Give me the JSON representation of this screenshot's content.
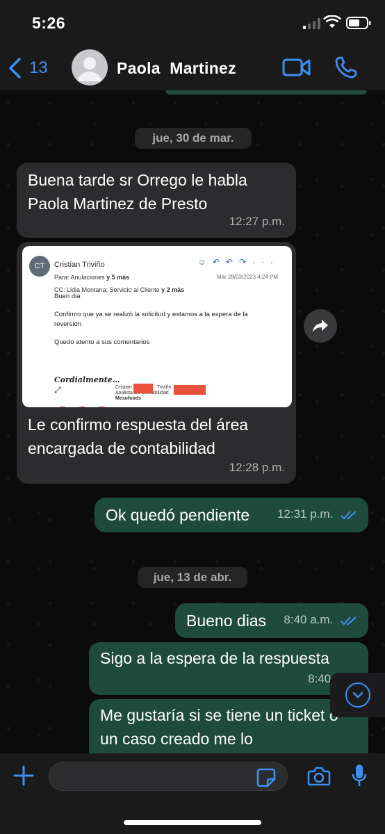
{
  "status_bar": {
    "time": "5:26"
  },
  "header": {
    "back_count": "13",
    "contact_name": "Paola  Martinez",
    "icons": [
      "chevron-left-icon",
      "avatar",
      "video-call-icon",
      "phone-icon"
    ]
  },
  "messages": {
    "date_1": "jue, 30 de mar.",
    "m1": {
      "text": "Buena tarde sr Orrego le habla Paola Martinez de Presto",
      "time": "12:27 p.m."
    },
    "email": {
      "initials": "CT",
      "sender": "Cristian Triviño",
      "to_label": "Para:",
      "to": "Anulaciones",
      "to_more": "y 5 más",
      "cc_label": "CC:",
      "cc": "Lidia Montana;  Servicio al Cliente",
      "cc_more": "y 2 más",
      "date": "Mar 28/03/2023 4:24 PM",
      "greeting": "Buen dia",
      "body_1": "Confirmo que ya se realizó la solicitud y estamos a la espera de la reversión",
      "body_2": "Quedo atento a sus comentarios",
      "closing": "Cordialmente…",
      "sig_name": "Cristian",
      "sig_surname": "Triviño",
      "sig_role": "Analista De Contabilidad",
      "sig_company": "Mesofoods"
    },
    "m2": {
      "text": "Le confirmo respuesta del área encargada de contabilidad",
      "time": "12:28 p.m."
    },
    "m3": {
      "text": "Ok quedó pendiente",
      "time": "12:31 p.m."
    },
    "date_2": "jue, 13 de abr.",
    "m4": {
      "text": "Bueno dias",
      "time": "8:40 a.m."
    },
    "m5": {
      "text": "Sigo a la espera de la respuesta",
      "time": "8:40 a.m."
    },
    "m6": {
      "text": "Me gustaría si se tiene un ticket o un caso creado me lo"
    }
  },
  "composer": {
    "input_placeholder": "",
    "icons": [
      "plus-icon",
      "sticker-icon",
      "camera-icon",
      "microphone-icon"
    ]
  },
  "colors": {
    "accent": "#3c90f3",
    "outgoing_bubble": "#1f4b3c",
    "incoming_bubble": "#2c2c2e"
  }
}
